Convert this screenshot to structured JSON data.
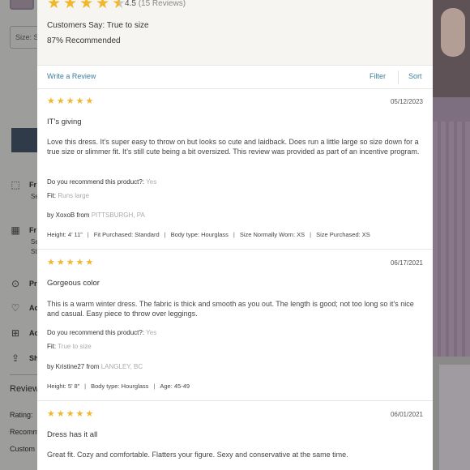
{
  "background": {
    "size_label": "Size: S",
    "features": [
      {
        "icon": "box-icon",
        "label": "Fr",
        "sub": "Se"
      },
      {
        "icon": "store-icon",
        "label": "Fr",
        "sub": "Se",
        "sub2": "St"
      },
      {
        "icon": "dots-circle-icon",
        "label": "Pr"
      },
      {
        "icon": "heart-icon",
        "label": "Ac"
      },
      {
        "icon": "gift-icon",
        "label": "Ac"
      },
      {
        "icon": "share-icon",
        "label": "Sh"
      }
    ],
    "reviews_heading": "Review",
    "rating_label": "Rating:",
    "recommend_label": "Recomm",
    "customers_label": "Custom"
  },
  "summary": {
    "rating": "4.5",
    "review_count": "(15 Reviews)",
    "customers_say_label": "Customers Say:",
    "customers_say_value": "True to size",
    "recommended": "87% Recommended"
  },
  "actions": {
    "write_review": "Write a Review",
    "filter": "Filter",
    "sort": "Sort"
  },
  "colors": {
    "star": "#f0b72a",
    "link": "#3d7fa0"
  },
  "reviews": [
    {
      "stars": 5,
      "date": "05/12/2023",
      "title": "IT’s giving",
      "body": "Love this dress. It’s super easy to throw on but looks so cute and laidback. Does run a little large so size down for a true size or slimmer fit. It’s still cute being a bit oversized. This review was provided as part of an incentive program.",
      "recommend_q": "Do you recommend this product?:",
      "recommend_a": "Yes",
      "fit_label": "Fit:",
      "fit_value": "Runs large",
      "by_prefix": "by XoxoB from",
      "location": "PITTSBURGH, PA",
      "stats": [
        "Height: 4’ 11”",
        "Fit Purchased: Standard",
        "Body type: Hourglass",
        "Size Normally Worn: XS",
        "Size Purchased: XS"
      ]
    },
    {
      "stars": 5,
      "date": "06/17/2021",
      "title": "Gorgeous color",
      "body": "This is a warm winter dress. The fabric is  thick and smooth as you out. The length is good; not too long so it’s nice and casual.  Easy piece to throw over leggings.",
      "recommend_q": "Do you recommend this product?:",
      "recommend_a": "Yes",
      "fit_label": "Fit:",
      "fit_value": "True to size",
      "by_prefix": "by Kristine27 from",
      "location": "LANGLEY, BC",
      "stats": [
        "Height: 5’ 8”",
        "Body type: Hourglass",
        "Age: 45-49"
      ]
    },
    {
      "stars": 5,
      "date": "06/01/2021",
      "title": "Dress has it all",
      "body": "Great fit. Cozy and comfortable. Flatters your figure. Sexy and conservative at the same time."
    }
  ]
}
